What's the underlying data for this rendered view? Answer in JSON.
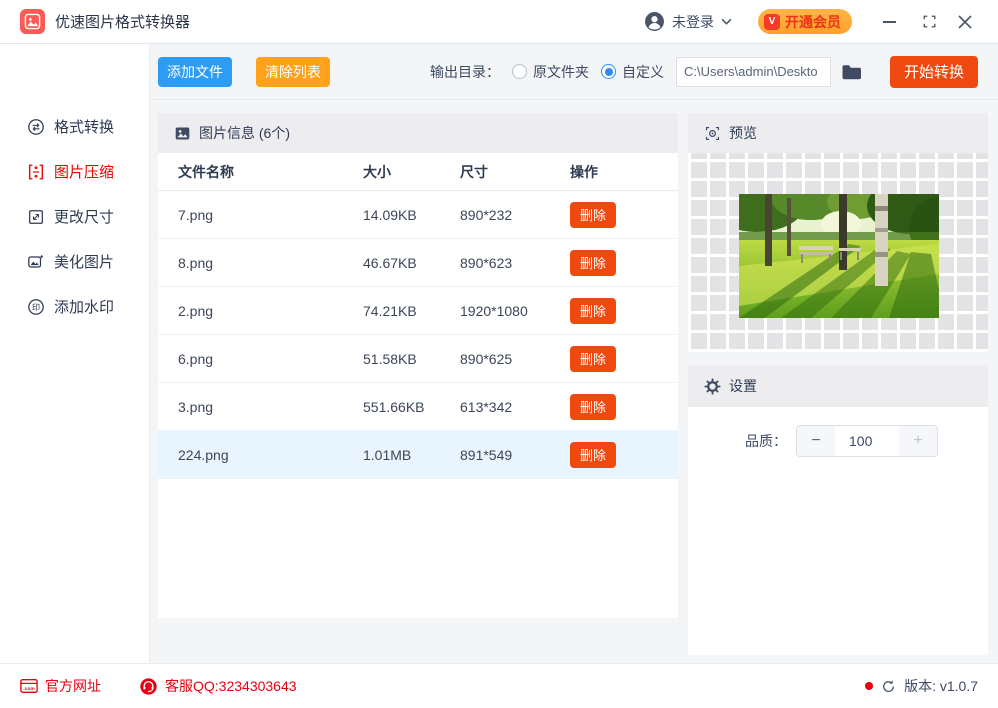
{
  "app": {
    "title": "优速图片格式转换器"
  },
  "titlebar": {
    "login_label": "未登录",
    "vip_icon_letter": "V",
    "vip_label": "开通会员"
  },
  "sidebar": {
    "items": [
      {
        "label": "格式转换",
        "active": false
      },
      {
        "label": "图片压缩",
        "active": true
      },
      {
        "label": "更改尺寸",
        "active": false
      },
      {
        "label": "美化图片",
        "active": false
      },
      {
        "label": "添加水印",
        "active": false
      }
    ]
  },
  "toolbar": {
    "add_files": "添加文件",
    "clear_list": "清除列表",
    "output_dir_label": "输出目录：",
    "radio_original": "原文件夹",
    "radio_custom": "自定义",
    "path_value": "C:\\Users\\admin\\Deskto",
    "start_convert": "开始转换"
  },
  "file_table": {
    "title": "图片信息 (6个)",
    "columns": {
      "name": "文件名称",
      "size": "大小",
      "dimensions": "尺寸",
      "action": "操作"
    },
    "delete_label": "删除",
    "rows": [
      {
        "name": "7.png",
        "size": "14.09KB",
        "dimensions": "890*232",
        "selected": false
      },
      {
        "name": "8.png",
        "size": "46.67KB",
        "dimensions": "890*623",
        "selected": false
      },
      {
        "name": "2.png",
        "size": "74.21KB",
        "dimensions": "1920*1080",
        "selected": false
      },
      {
        "name": "6.png",
        "size": "51.58KB",
        "dimensions": "890*625",
        "selected": false
      },
      {
        "name": "3.png",
        "size": "551.66KB",
        "dimensions": "613*342",
        "selected": false
      },
      {
        "name": "224.png",
        "size": "1.01MB",
        "dimensions": "891*549",
        "selected": true
      }
    ]
  },
  "preview": {
    "title": "预览"
  },
  "settings": {
    "title": "设置",
    "quality_label": "品质：",
    "quality_value": "100",
    "minus": "−",
    "plus": "+"
  },
  "footer": {
    "website": "官方网址",
    "qq": "客服QQ:3234303643",
    "version_label": "版本:",
    "version_value": "v1.0.7"
  },
  "colors": {
    "brand_red": "#fb5a55",
    "accent_blue": "#2d9cf4",
    "accent_orange": "#ffa21b",
    "primary_orange_red": "#f0490f",
    "sidebar_active_red": "#e60000",
    "footer_red": "#e60012",
    "selected_row_blue": "#e9f5fe",
    "vip_pill_orange": "#ffa126"
  }
}
